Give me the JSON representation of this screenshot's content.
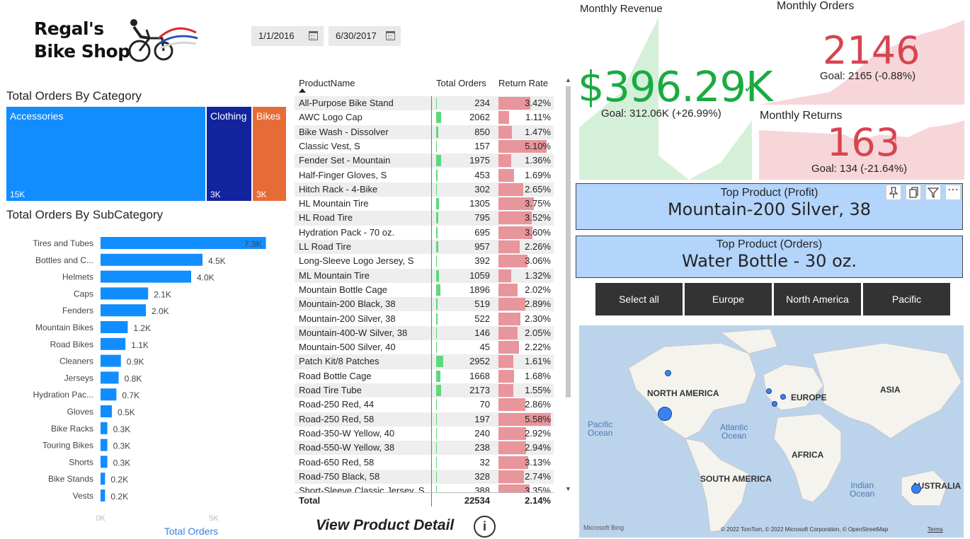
{
  "logo": {
    "line1": "Regal's",
    "line2": "Bike Shop"
  },
  "date_filter": {
    "start": "1/1/2016",
    "end": "6/30/2017"
  },
  "category": {
    "title": "Total Orders By Category",
    "items": [
      {
        "label": "Accessories",
        "value": "15K",
        "color": "#118dff"
      },
      {
        "label": "Clothing",
        "value": "3K",
        "color": "#12239e"
      },
      {
        "label": "Bikes",
        "value": "3K",
        "color": "#e66c37"
      }
    ]
  },
  "chart_data": {
    "type": "bar",
    "title": "Total Orders By SubCategory",
    "xlabel": "Total Orders",
    "xlim": [
      0,
      5000
    ],
    "x_ticks": [
      "0K",
      "5K"
    ],
    "categories": [
      "Tires and Tubes",
      "Bottles and C...",
      "Helmets",
      "Caps",
      "Fenders",
      "Mountain Bikes",
      "Road Bikes",
      "Cleaners",
      "Jerseys",
      "Hydration Pac...",
      "Gloves",
      "Bike Racks",
      "Touring Bikes",
      "Shorts",
      "Bike Stands",
      "Vests"
    ],
    "values": [
      7300,
      4500,
      4000,
      2100,
      2000,
      1200,
      1100,
      900,
      800,
      700,
      500,
      300,
      300,
      300,
      200,
      200
    ],
    "labels": [
      "7.3K",
      "4.5K",
      "4.0K",
      "2.1K",
      "2.0K",
      "1.2K",
      "1.1K",
      "0.9K",
      "0.8K",
      "0.7K",
      "0.5K",
      "0.3K",
      "0.3K",
      "0.3K",
      "0.2K",
      "0.2K"
    ],
    "color": "#118dff",
    "legend": "none",
    "grid": false
  },
  "table": {
    "headers": {
      "product": "ProductName",
      "orders": "Total Orders",
      "return": "Return Rate"
    },
    "rows": [
      {
        "name": "All-Purpose Bike Stand",
        "orders": 234,
        "rate": "3.42%"
      },
      {
        "name": "AWC Logo Cap",
        "orders": 2062,
        "rate": "1.11%"
      },
      {
        "name": "Bike Wash - Dissolver",
        "orders": 850,
        "rate": "1.47%"
      },
      {
        "name": "Classic Vest, S",
        "orders": 157,
        "rate": "5.10%"
      },
      {
        "name": "Fender Set - Mountain",
        "orders": 1975,
        "rate": "1.36%"
      },
      {
        "name": "Half-Finger Gloves, S",
        "orders": 453,
        "rate": "1.69%"
      },
      {
        "name": "Hitch Rack - 4-Bike",
        "orders": 302,
        "rate": "2.65%"
      },
      {
        "name": "HL Mountain Tire",
        "orders": 1305,
        "rate": "3.75%"
      },
      {
        "name": "HL Road Tire",
        "orders": 795,
        "rate": "3.52%"
      },
      {
        "name": "Hydration Pack - 70 oz.",
        "orders": 695,
        "rate": "3.60%"
      },
      {
        "name": "LL Road Tire",
        "orders": 957,
        "rate": "2.26%"
      },
      {
        "name": "Long-Sleeve Logo Jersey, S",
        "orders": 392,
        "rate": "3.06%"
      },
      {
        "name": "ML Mountain Tire",
        "orders": 1059,
        "rate": "1.32%"
      },
      {
        "name": "Mountain Bottle Cage",
        "orders": 1896,
        "rate": "2.02%"
      },
      {
        "name": "Mountain-200 Black, 38",
        "orders": 519,
        "rate": "2.89%"
      },
      {
        "name": "Mountain-200 Silver, 38",
        "orders": 522,
        "rate": "2.30%"
      },
      {
        "name": "Mountain-400-W Silver, 38",
        "orders": 146,
        "rate": "2.05%"
      },
      {
        "name": "Mountain-500 Silver, 40",
        "orders": 45,
        "rate": "2.22%"
      },
      {
        "name": "Patch Kit/8 Patches",
        "orders": 2952,
        "rate": "1.61%"
      },
      {
        "name": "Road Bottle Cage",
        "orders": 1668,
        "rate": "1.68%"
      },
      {
        "name": "Road Tire Tube",
        "orders": 2173,
        "rate": "1.55%"
      },
      {
        "name": "Road-250 Red, 44",
        "orders": 70,
        "rate": "2.86%"
      },
      {
        "name": "Road-250 Red, 58",
        "orders": 197,
        "rate": "5.58%"
      },
      {
        "name": "Road-350-W Yellow, 40",
        "orders": 240,
        "rate": "2.92%"
      },
      {
        "name": "Road-550-W Yellow, 38",
        "orders": 238,
        "rate": "2.94%"
      },
      {
        "name": "Road-650 Red, 58",
        "orders": 32,
        "rate": "3.13%"
      },
      {
        "name": "Road-750 Black, 58",
        "orders": 328,
        "rate": "2.74%"
      },
      {
        "name": "Short-Sleeve Classic Jersey, S",
        "orders": 388,
        "rate": "3.35%"
      }
    ],
    "total": {
      "label": "Total",
      "orders": "22534",
      "rate": "2.14%"
    },
    "max_orders": 22534,
    "max_rate": 5.58
  },
  "view_detail": "View Product Detail",
  "revenue": {
    "title": "Monthly Revenue",
    "value": "$396.29K",
    "goal": "Goal: 312.06K (+26.99%)",
    "status": "✓"
  },
  "orders": {
    "title": "Monthly Orders",
    "value": "2146",
    "goal": "Goal: 2165 (-0.88%)",
    "status": "!"
  },
  "returns": {
    "title": "Monthly Returns",
    "value": "163",
    "goal": "Goal: 134 (-21.64%)",
    "status": "!"
  },
  "top_profit": {
    "title": "Top Product (Profit)",
    "value": "Mountain-200 Silver, 38"
  },
  "top_orders": {
    "title": "Top Product (Orders)",
    "value": "Water Bottle - 30 oz."
  },
  "regions": [
    "Select all",
    "Europe",
    "North America",
    "Pacific"
  ],
  "map": {
    "continents": [
      "NORTH AMERICA",
      "EUROPE",
      "ASIA",
      "AFRICA",
      "SOUTH AMERICA",
      "AUSTRALIA"
    ],
    "oceans": {
      "pacific": [
        "Pacific",
        "Ocean"
      ],
      "atlantic": [
        "Atlantic",
        "Ocean"
      ],
      "indian": [
        "Indian",
        "Ocean"
      ]
    },
    "attribution": "© 2022 TomTom, © 2022 Microsoft Corporation, © OpenStreetMap",
    "terms": "Terms",
    "bing": "Microsoft Bing"
  },
  "colors": {
    "accent": "#118dff",
    "good": "#1aab40",
    "bad": "#d64550",
    "good_area": "#d4f0d9",
    "bad_area": "#f7d6d9"
  }
}
